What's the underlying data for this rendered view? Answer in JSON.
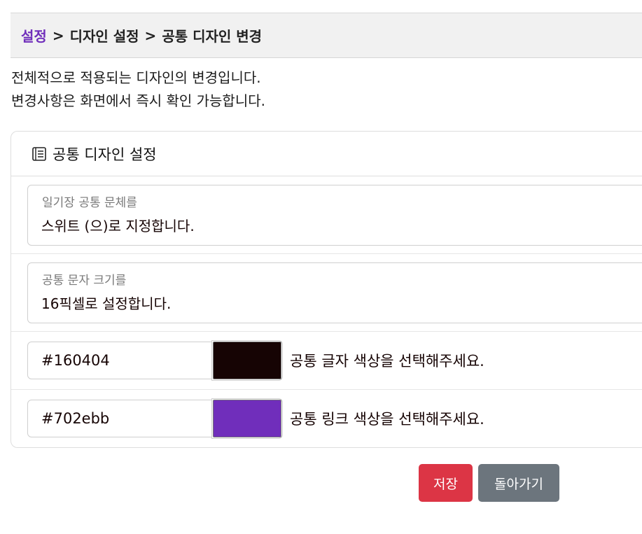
{
  "breadcrumb": {
    "root": "설정",
    "separator": ">",
    "level2": "디자인 설정",
    "level3": "공통 디자인 변경"
  },
  "description": {
    "line1": "전체적으로 적용되는 디자인의 변경입니다.",
    "line2": "변경사항은 화면에서 즉시 확인 가능합니다."
  },
  "card": {
    "header_icon": "list-document-icon",
    "title": "공통 디자인 설정",
    "font_family_field": {
      "label": "일기장 공통 문체를",
      "value": "스위트 (으)로 지정합니다."
    },
    "font_size_field": {
      "label": "공통 문자 크기를",
      "value": "16픽셀로 설정합니다."
    },
    "text_color": {
      "value": "#160404",
      "swatch": "#160404",
      "hint": "공통 글자 색상을 선택해주세요."
    },
    "link_color": {
      "value": "#702ebb",
      "swatch": "#702ebb",
      "hint": "공통 링크 색상을 선택해주세요."
    }
  },
  "buttons": {
    "save": "저장",
    "back": "돌아가기"
  },
  "colors": {
    "accent": "#702ebb",
    "danger": "#dc3545",
    "secondary": "#6c757d"
  }
}
